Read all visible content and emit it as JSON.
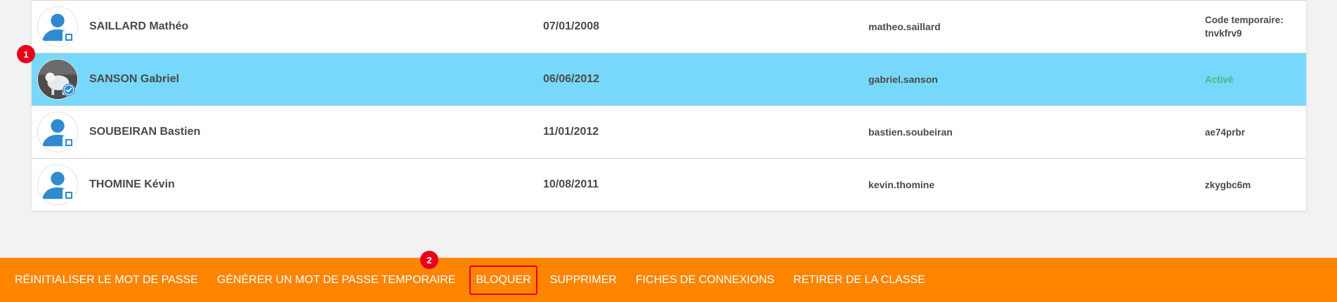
{
  "students": [
    {
      "name": "SAILLARD Mathéo",
      "birthdate": "07/01/2008",
      "login": "matheo.saillard",
      "code_line1": "Code temporaire:",
      "code_line2": "tnvkfrv9",
      "avatar": "user-silhouette-icon",
      "selected": false
    },
    {
      "name": "SANSON Gabriel",
      "birthdate": "06/06/2012",
      "login": "gabriel.sanson",
      "code_line1": "Activé",
      "code_line2": "",
      "avatar": "photo",
      "selected": true
    },
    {
      "name": "SOUBEIRAN Bastien",
      "birthdate": "11/01/2012",
      "login": "bastien.soubeiran",
      "code_line1": "ae74prbr",
      "code_line2": "",
      "avatar": "user-silhouette-icon",
      "selected": false
    },
    {
      "name": "THOMINE Kévin",
      "birthdate": "10/08/2011",
      "login": "kevin.thomine",
      "code_line1": "zkygbc6m",
      "code_line2": "",
      "avatar": "user-silhouette-icon",
      "selected": false
    }
  ],
  "markers": {
    "one": "1",
    "two": "2"
  },
  "toolbar": {
    "reset_password": "RÉINITIALISER LE MOT DE PASSE",
    "generate_temp_password": "GÉNÉRER UN MOT DE PASSE TEMPORAIRE",
    "block": "BLOQUER",
    "delete": "SUPPRIMER",
    "connection_sheets": "FICHES DE CONNEXIONS",
    "remove_from_class": "RETIRER DE LA CLASSE"
  },
  "colors": {
    "selected_row": "#78d8fb",
    "toolbar": "#ff8500",
    "active_status": "#3dbe7e",
    "marker": "#e8001b",
    "avatar_blue": "#2f8ad0"
  }
}
